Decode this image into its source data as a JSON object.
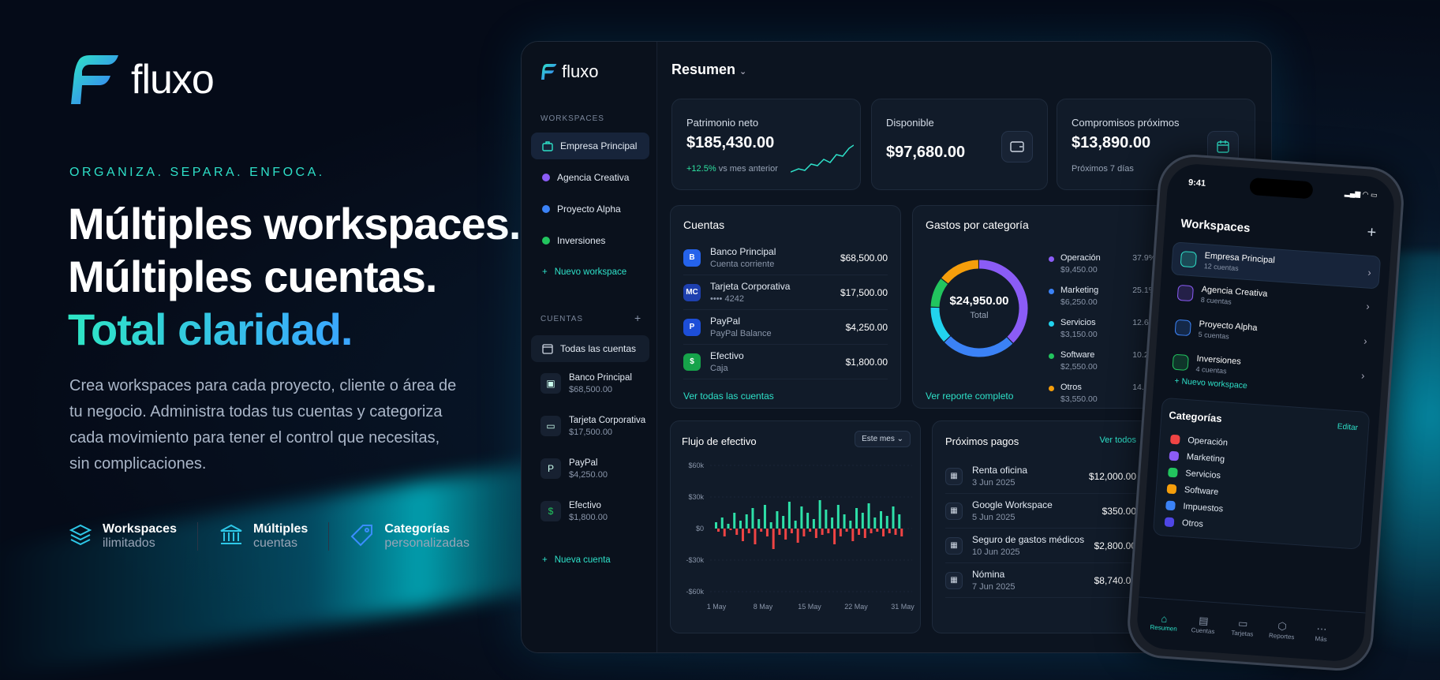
{
  "hero": {
    "brand": "fluxo",
    "tagline": "ORGANIZA. SEPARA. ENFOCA.",
    "line1": "Múltiples workspaces.",
    "line2": "Múltiples cuentas.",
    "line3": "Total claridad.",
    "description": "Crea workspaces para cada proyecto, cliente o área de tu negocio. Administra todas tus cuentas y categoriza cada movimiento para tener el control que necesitas, sin complicaciones.",
    "features": [
      {
        "title": "Workspaces",
        "sub": "ilimitados",
        "icon": "layers-icon"
      },
      {
        "title": "Múltiples",
        "sub": "cuentas",
        "icon": "bank-icon"
      },
      {
        "title": "Categorías",
        "sub": "personalizadas",
        "icon": "tag-icon"
      }
    ]
  },
  "sidebar": {
    "brand": "fluxo",
    "ws_header": "WORKSPACES",
    "workspaces": [
      {
        "label": "Empresa Principal",
        "color": "#2ee0c8"
      },
      {
        "label": "Agencia Creativa",
        "color": "#8b5cf6"
      },
      {
        "label": "Proyecto Alpha",
        "color": "#3b82f6"
      },
      {
        "label": "Inversiones",
        "color": "#22c55e"
      }
    ],
    "new_workspace": "Nuevo workspace",
    "acc_header": "CUENTAS",
    "all_accounts": "Todas las cuentas",
    "accounts": [
      {
        "name": "Banco Principal",
        "value": "$68,500.00"
      },
      {
        "name": "Tarjeta Corporativa",
        "value": "$17,500.00"
      },
      {
        "name": "PayPal",
        "value": "$4,250.00"
      },
      {
        "name": "Efectivo",
        "value": "$1,800.00"
      }
    ],
    "new_account": "Nueva cuenta"
  },
  "main": {
    "title": "Resumen",
    "kpis": {
      "net_label": "Patrimonio neto",
      "net_value": "$185,430.00",
      "net_change": "+12.5%",
      "net_change_suffix": "vs mes anterior",
      "avail_label": "Disponible",
      "avail_value": "$97,680.00",
      "comm_label": "Compromisos próximos",
      "comm_value": "$13,890.00",
      "comm_sub": "Próximos 7 días"
    },
    "cuentas": {
      "title": "Cuentas",
      "rows": [
        {
          "name": "Banco Principal",
          "sub": "Cuenta corriente",
          "amount": "$68,500.00",
          "color": "#2563eb",
          "glyph": "B"
        },
        {
          "name": "Tarjeta Corporativa",
          "sub": "•••• 4242",
          "amount": "$17,500.00",
          "color": "#1e40af",
          "glyph": "MC"
        },
        {
          "name": "PayPal",
          "sub": "PayPal Balance",
          "amount": "$4,250.00",
          "color": "#1d4ed8",
          "glyph": "P"
        },
        {
          "name": "Efectivo",
          "sub": "Caja",
          "amount": "$1,800.00",
          "color": "#16a34a",
          "glyph": "$"
        }
      ],
      "link": "Ver todas las cuentas"
    },
    "gastos": {
      "title": "Gastos por categoría",
      "total": "$24,950.00",
      "total_label": "Total",
      "link": "Ver reporte completo",
      "items": [
        {
          "name": "Operación",
          "amount": "$9,450.00",
          "pct": "37.9%",
          "color": "#8b5cf6"
        },
        {
          "name": "Marketing",
          "amount": "$6,250.00",
          "pct": "25.1%",
          "color": "#3b82f6"
        },
        {
          "name": "Servicios",
          "amount": "$3,150.00",
          "pct": "12.6%",
          "color": "#22d3ee"
        },
        {
          "name": "Software",
          "amount": "$2,550.00",
          "pct": "10.2%",
          "color": "#22c55e"
        },
        {
          "name": "Otros",
          "amount": "$3,550.00",
          "pct": "14.2%",
          "color": "#f59e0b"
        }
      ]
    },
    "flujo": {
      "title": "Flujo de efectivo",
      "period": "Este mes",
      "yticks": [
        "$60k",
        "$30k",
        "$0",
        "-$30k",
        "-$60k"
      ],
      "xticks": [
        "1 May",
        "8 May",
        "15 May",
        "22 May",
        "31 May"
      ]
    },
    "pagos": {
      "title": "Próximos pagos",
      "link": "Ver todos",
      "rows": [
        {
          "name": "Renta oficina",
          "date": "3 Jun 2025",
          "amount": "$12,000.00"
        },
        {
          "name": "Google Workspace",
          "date": "5 Jun 2025",
          "amount": "$350.00"
        },
        {
          "name": "Seguro de gastos médicos",
          "date": "10 Jun 2025",
          "amount": "$2,800.00"
        },
        {
          "name": "Nómina",
          "date": "7 Jun 2025",
          "amount": "$8,740.00"
        }
      ]
    }
  },
  "phone": {
    "time": "9:41",
    "title": "Workspaces",
    "workspaces": [
      {
        "name": "Empresa Principal",
        "sub": "12 cuentas",
        "color": "#2ee0c8"
      },
      {
        "name": "Agencia Creativa",
        "sub": "8 cuentas",
        "color": "#8b5cf6"
      },
      {
        "name": "Proyecto Alpha",
        "sub": "5 cuentas",
        "color": "#3b82f6"
      },
      {
        "name": "Inversiones",
        "sub": "4 cuentas",
        "color": "#22c55e"
      }
    ],
    "new_workspace": "Nuevo workspace",
    "cat_title": "Categorías",
    "cat_edit": "Editar",
    "categories": [
      {
        "name": "Operación",
        "color": "#ef4444"
      },
      {
        "name": "Marketing",
        "color": "#8b5cf6"
      },
      {
        "name": "Servicios",
        "color": "#22c55e"
      },
      {
        "name": "Software",
        "color": "#f59e0b"
      },
      {
        "name": "Impuestos",
        "color": "#3b82f6"
      },
      {
        "name": "Otros",
        "color": "#4f46e5"
      }
    ],
    "tabs": [
      "Resumen",
      "Cuentas",
      "Tarjetas",
      "Reportes",
      "Más"
    ]
  }
}
